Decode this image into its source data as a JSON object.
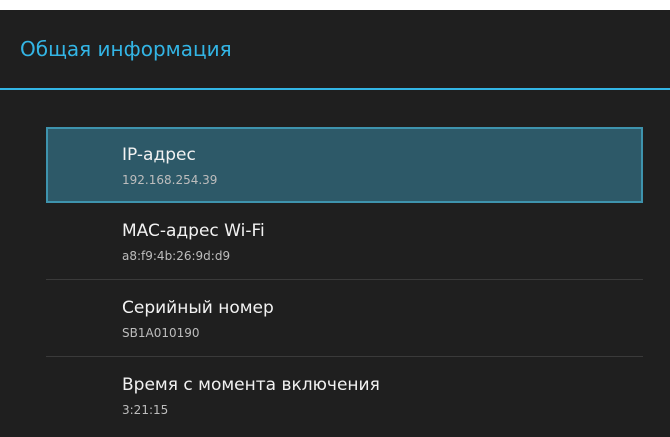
{
  "header": {
    "title": "Общая информация"
  },
  "items": [
    {
      "title": "IP-адрес",
      "value": "192.168.254.39"
    },
    {
      "title": "MAC-адрес Wi-Fi",
      "value": "a8:f9:4b:26:9d:d9"
    },
    {
      "title": "Серийный номер",
      "value": "SB1A010190"
    },
    {
      "title": "Время с момента включения",
      "value": "3:21:15"
    }
  ],
  "colors": {
    "background": "#1f1f1f",
    "accent": "#33b5e5",
    "selected_fill": "#2d5968",
    "selected_border": "#3e93ad"
  }
}
